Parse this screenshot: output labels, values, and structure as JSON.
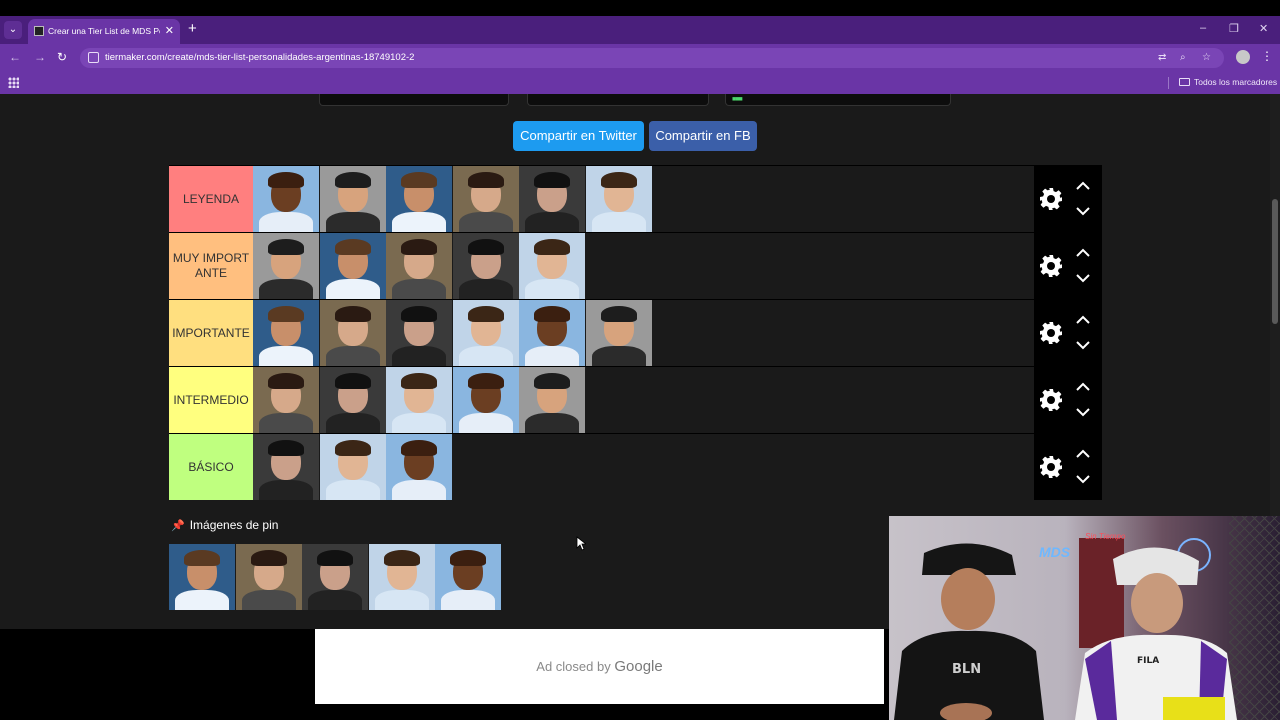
{
  "browser": {
    "tab_title": "Crear una Tier List de MDS Personalidades Argentinas",
    "new_tab_symbol": "+",
    "close_symbol": "✕",
    "url": "tiermaker.com/create/mds-tier-list-personalidades-argentinas-18749102-2",
    "bookmarks_label": "Todos los marcadores",
    "accent_color": "#6a35a6"
  },
  "share": {
    "twitter_label": "Compartir en Twitter",
    "facebook_label": "Compartir en FB"
  },
  "tiers": [
    {
      "label": "LEYENDA",
      "color": "#ff7f7f",
      "item_count": 6
    },
    {
      "label": "MUY IMPORTANTE",
      "color": "#ffbf7f",
      "item_count": 5
    },
    {
      "label": "IMPORTANTE",
      "color": "#ffdf7f",
      "item_count": 6
    },
    {
      "label": "INTERMEDIO",
      "color": "#ffff7f",
      "item_count": 5
    },
    {
      "label": "BÁSICO",
      "color": "#bfff7f",
      "item_count": 3
    }
  ],
  "pinned": {
    "title": "Imágenes de pin",
    "item_count": 5
  },
  "ad": {
    "closed_text": "Ad closed by",
    "brand": "Google"
  },
  "webcam": {
    "neon_sign": "MDS",
    "neon_script": "Sin Tiempo"
  }
}
